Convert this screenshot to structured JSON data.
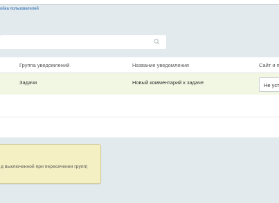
{
  "breadcrumb": {
    "text": "ойка пользователей"
  },
  "search": {
    "value": "",
    "placeholder": "",
    "icon": "search-icon"
  },
  "table": {
    "columns": [
      "Группа уведомлений",
      "Название уведомления",
      "Сайт и п"
    ],
    "rows": [
      {
        "group": "Задачи",
        "name": "Новый комментарий к задаче",
        "site": "Не уст"
      }
    ]
  },
  "note": {
    "text": "д выключенной при пересечении групп)"
  },
  "colors": {
    "background": "#e3eaed",
    "row_highlight": "#f1f7e2",
    "note_background": "#f5f0c4",
    "link": "#2067b0"
  }
}
